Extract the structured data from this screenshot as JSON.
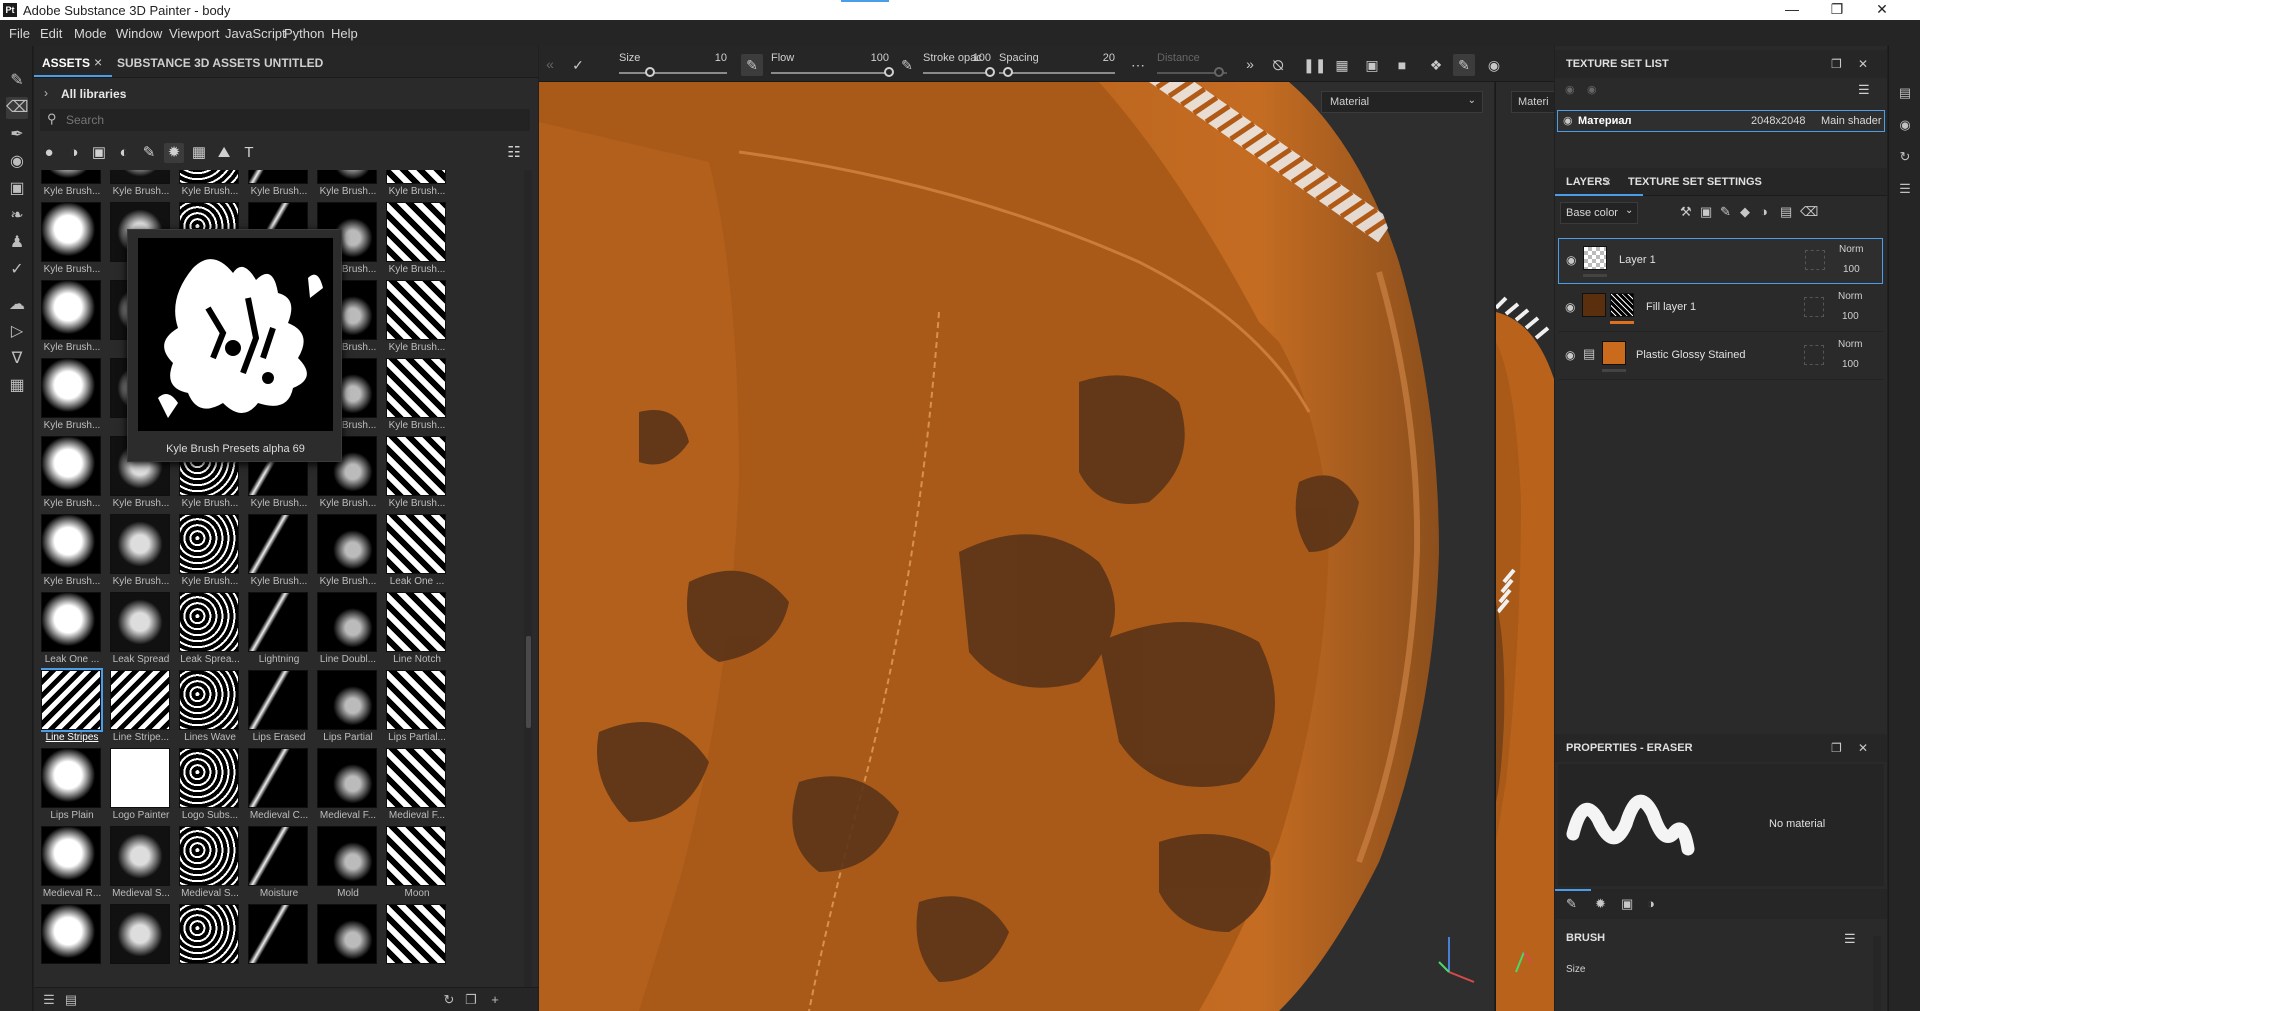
{
  "titlebar": {
    "title": "Adobe Substance 3D Painter - body",
    "logo": "Pt"
  },
  "menu": [
    "File",
    "Edit",
    "Mode",
    "Window",
    "Viewport",
    "JavaScript",
    "Python",
    "Help"
  ],
  "assets": {
    "tabs": [
      "ASSETS",
      "SUBSTANCE 3D ASSETS",
      "UNTITLED"
    ],
    "library": "All libraries",
    "search_placeholder": "Search",
    "preview_caption": "Kyle Brush Presets alpha 69",
    "items": [
      "Kyle Brush...",
      "Kyle Brush...",
      "Kyle Brush...",
      "Kyle Brush...",
      "Kyle Brush...",
      "Kyle Brush...",
      "Kyle Brush...",
      "",
      "",
      "",
      "Kyle Brush...",
      "Kyle Brush...",
      "Kyle Brush...",
      "",
      "",
      "",
      "Kyle Brush...",
      "Kyle Brush...",
      "Kyle Brush...",
      "",
      "",
      "",
      "Kyle Brush...",
      "Kyle Brush...",
      "Kyle Brush...",
      "Kyle Brush...",
      "Kyle Brush...",
      "Kyle Brush...",
      "Kyle Brush...",
      "Kyle Brush...",
      "Kyle Brush...",
      "Kyle Brush...",
      "Kyle Brush...",
      "Kyle Brush...",
      "Kyle Brush...",
      "Leak One ...",
      "Leak One ...",
      "Leak Spread",
      "Leak Sprea...",
      "Lightning",
      "Line Doubl...",
      "Line Notch",
      "Line Stripes",
      "Line Stripe...",
      "Lines Wave",
      "Lips Erased",
      "Lips Partial",
      "Lips Partial...",
      "Lips Plain",
      "Logo Painter",
      "Logo Subs...",
      "Medieval C...",
      "Medieval F...",
      "Medieval F...",
      "Medieval R...",
      "Medieval S...",
      "Medieval S...",
      "Moisture",
      "Mold",
      "Moon",
      "",
      "",
      "",
      "",
      "",
      ""
    ],
    "selected_item": "Line Stripes"
  },
  "toolbar": {
    "size_label": "Size",
    "size_value": "10",
    "flow_label": "Flow",
    "flow_value": "100",
    "stroke_label": "Stroke opac",
    "stroke_value": "100",
    "spacing_label": "Spacing",
    "spacing_value": "20",
    "distance_label": "Distance"
  },
  "viewport": {
    "material_select": "Material",
    "material_select_2d": "Materi"
  },
  "texture_set_list": {
    "title": "TEXTURE SET LIST",
    "set_name": "Материал",
    "resolution": "2048x2048",
    "shader": "Main shader"
  },
  "layers": {
    "tabs": [
      "LAYERS",
      "TEXTURE SET SETTINGS"
    ],
    "channel": "Base color",
    "rows": [
      {
        "name": "Layer 1",
        "blend": "Norm",
        "opacity": "100"
      },
      {
        "name": "Fill layer 1",
        "blend": "Norm",
        "opacity": "100"
      },
      {
        "name": "Plastic Glossy Stained",
        "blend": "Norm",
        "opacity": "100"
      }
    ]
  },
  "properties": {
    "title": "PROPERTIES - ERASER",
    "no_material": "No material",
    "section": "BRUSH",
    "size_label": "Size"
  },
  "colors": {
    "accent": "#4a9ee8",
    "surface_orange": "#b8621c",
    "panel": "#2a2a2a"
  }
}
